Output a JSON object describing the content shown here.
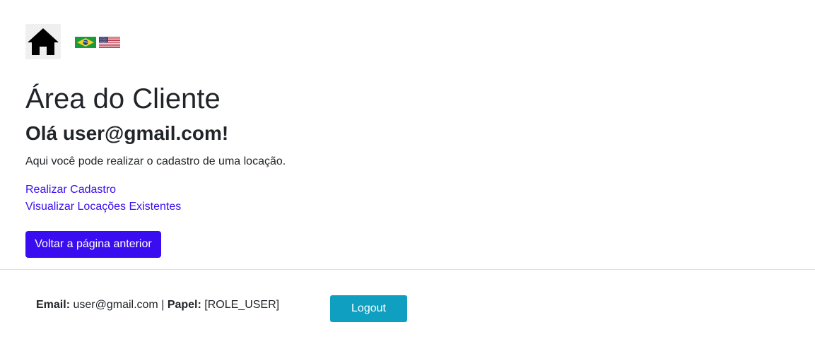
{
  "header": {
    "home_icon": "home-icon",
    "languages": [
      {
        "code": "pt-BR",
        "icon": "flag-brazil-icon"
      },
      {
        "code": "en-US",
        "icon": "flag-usa-icon"
      }
    ]
  },
  "main": {
    "title": "Área do Cliente",
    "greeting": "Olá user@gmail.com!",
    "intro": "Aqui você pode realizar o cadastro de uma locação.",
    "links": [
      {
        "label": "Realizar Cadastro"
      },
      {
        "label": "Visualizar Locações Existentes"
      }
    ],
    "back_button": "Voltar a página anterior"
  },
  "footer": {
    "email_label": "Email:",
    "email_value": "user@gmail.com",
    "separator": "|",
    "role_label": "Papel:",
    "role_value": "[ROLE_USER]",
    "logout_button": "Logout"
  },
  "colors": {
    "primary": "#3a0df0",
    "logout": "#0e9fc1",
    "text": "#212529"
  }
}
